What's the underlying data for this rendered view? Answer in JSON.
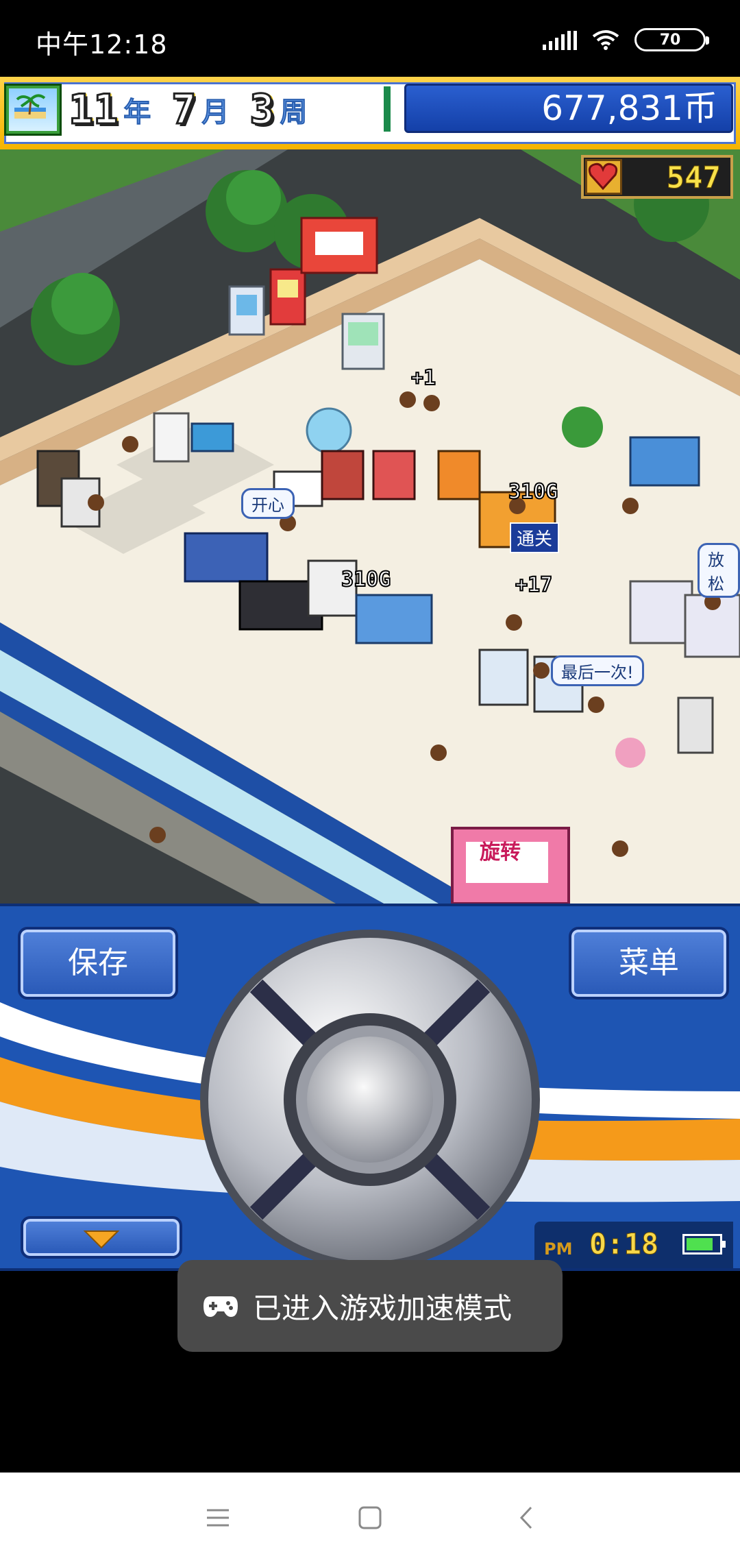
{
  "status_bar": {
    "time": "中午12:18",
    "battery_level": "70",
    "signal_icon": "signal-bars-icon",
    "wifi_icon": "wifi-icon"
  },
  "hud": {
    "year_value": "11",
    "year_unit": "年",
    "month_value": "7",
    "month_unit": "月",
    "week_value": "3",
    "week_unit": "周",
    "money": "677,831币",
    "season_icon": "summer-palm-icon"
  },
  "world": {
    "hearts": "547",
    "bubbles": {
      "happy": "开心",
      "relax": "放松",
      "last_time": "最后一次!"
    },
    "floats": {
      "plus_1": "+1",
      "plus_17": "+17",
      "coins_a": "310G",
      "coins_b": "310G"
    },
    "clear_tag": "通关",
    "sign": "旋转"
  },
  "panel": {
    "save_label": "保存",
    "menu_label": "菜单",
    "clock_pm": "PM",
    "clock_time": "0:18"
  },
  "toast": {
    "text": "已进入游戏加速模式",
    "icon": "gamepad-icon"
  },
  "navbar": {
    "menu_icon": "recent-apps-icon",
    "home_icon": "home-icon",
    "back_icon": "back-icon"
  },
  "colors": {
    "panel_blue": "#1e55b3",
    "hud_gold": "#f5b400",
    "floor_cream": "#f4efe2"
  }
}
